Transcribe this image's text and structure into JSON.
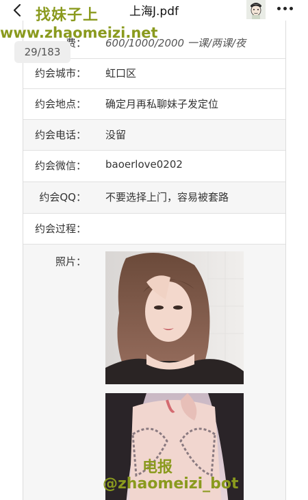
{
  "header": {
    "title": "上海J.pdf",
    "back_icon": "chevron-left-icon",
    "more_icon": "more-dots-icon"
  },
  "watermarks": {
    "title": "找妹子上",
    "url": "www.zhaomeizi.net",
    "telegram_label": "电报",
    "telegram_handle": "@zhaomeizi_bot"
  },
  "pager": {
    "current": "29/183"
  },
  "rows": [
    {
      "label": "费：",
      "value": "600/1000/2000 一课/两课/夜"
    },
    {
      "label": "约会城市：",
      "value": "虹口区"
    },
    {
      "label": "约会地点：",
      "value": "确定月再私聊妹子发定位"
    },
    {
      "label": "约会电话：",
      "value": "没留"
    },
    {
      "label": "约会微信：",
      "value": "baoerlove0202"
    },
    {
      "label": "约会QQ：",
      "value": "不要选择上门，容易被套路"
    },
    {
      "label": "约会过程：",
      "value": ""
    },
    {
      "label": "照片：",
      "value": ""
    }
  ],
  "colors": {
    "watermark": "#8a9a1e",
    "row_border": "#e0e0e0",
    "row_shade": "#f6f6f6"
  }
}
